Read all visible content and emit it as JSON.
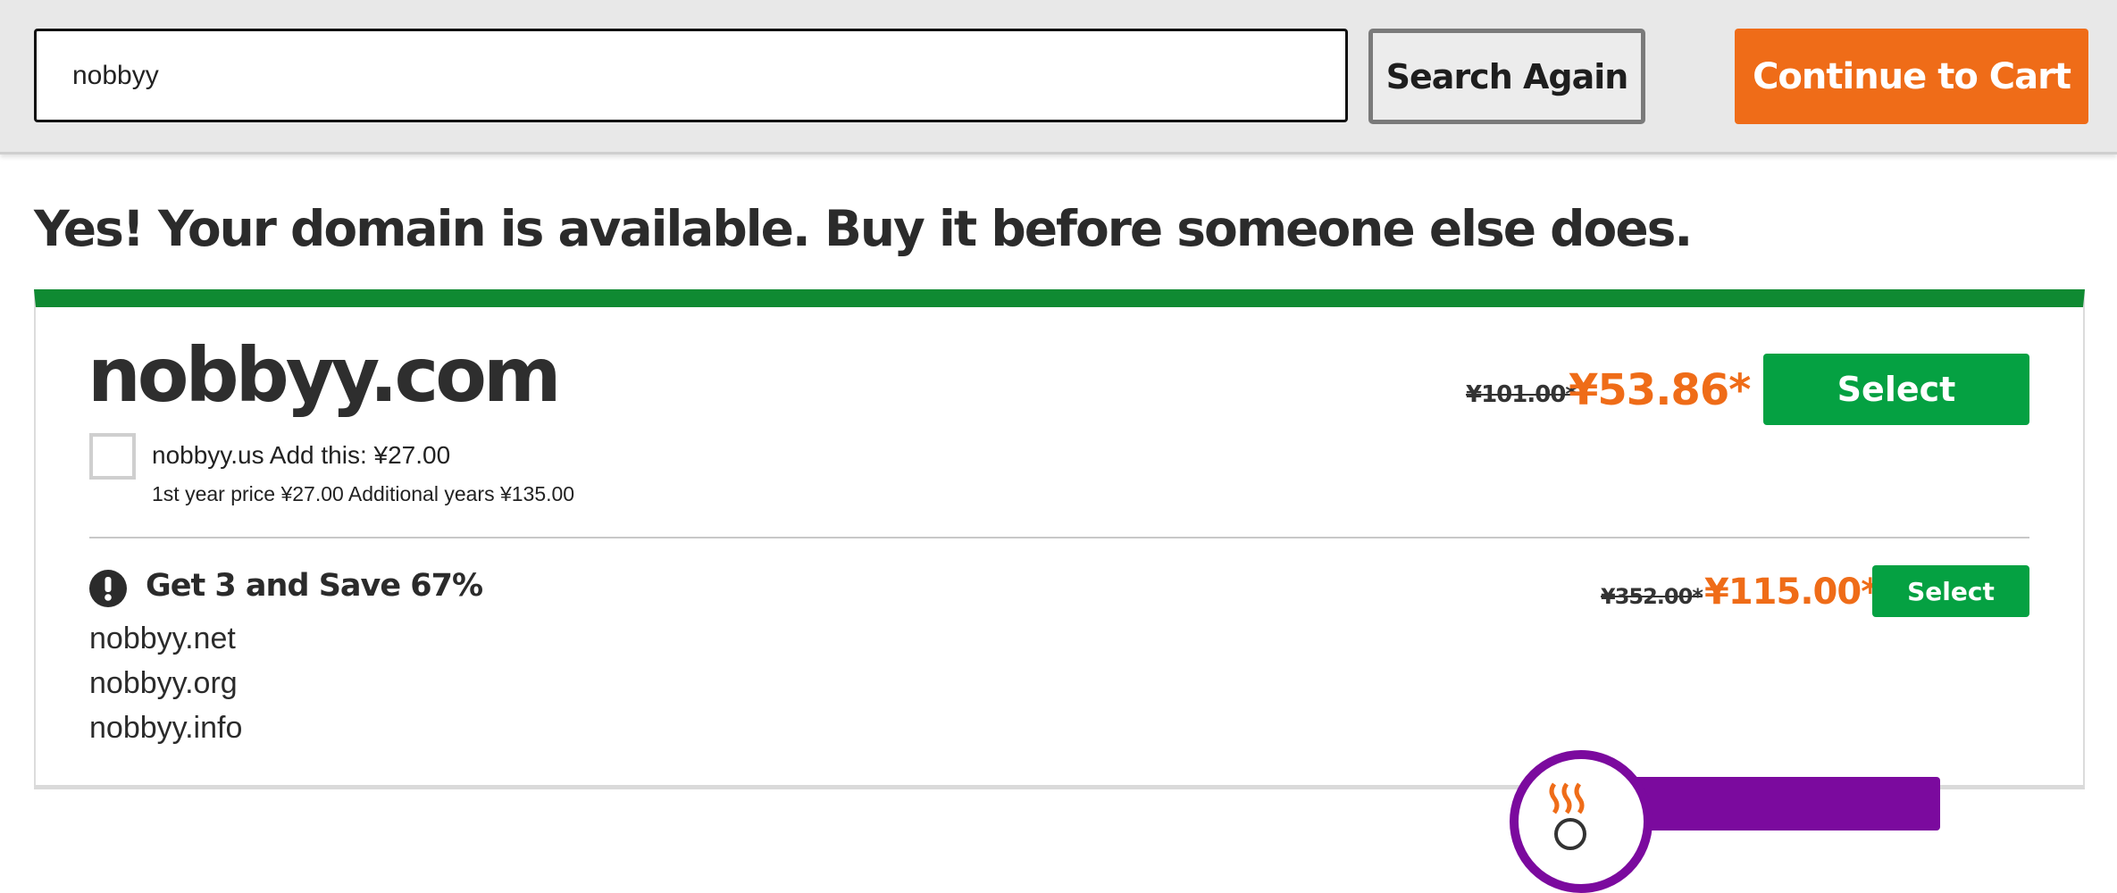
{
  "search": {
    "value": "nobbyy",
    "search_again_label": "Search Again",
    "continue_label": "Continue to Cart"
  },
  "headline": "Yes! Your domain is available. Buy it before someone else does.",
  "primary": {
    "domain": "nobbyy.com",
    "old_price": "¥101.00*",
    "new_price": "¥53.86*",
    "select_label": "Select",
    "addon": {
      "label": "nobbyy.us Add this: ¥27.00",
      "detail": "1st year price ¥27.00 Additional years ¥135.00",
      "checked": false
    }
  },
  "bundle": {
    "title": "Get 3 and Save 67%",
    "old_price": "¥352.00*",
    "new_price": "¥115.00*",
    "select_label": "Select",
    "domains": [
      "nobbyy.net",
      "nobbyy.org",
      "nobbyy.info"
    ]
  },
  "colors": {
    "accent_orange": "#ef6c18",
    "select_green": "#05a142",
    "card_top_green": "#0f8a32",
    "chat_purple": "#7b0a9e"
  },
  "icons": {
    "bundle_alert": "exclamation-circle-icon",
    "chat": "chat-avatar-icon"
  }
}
